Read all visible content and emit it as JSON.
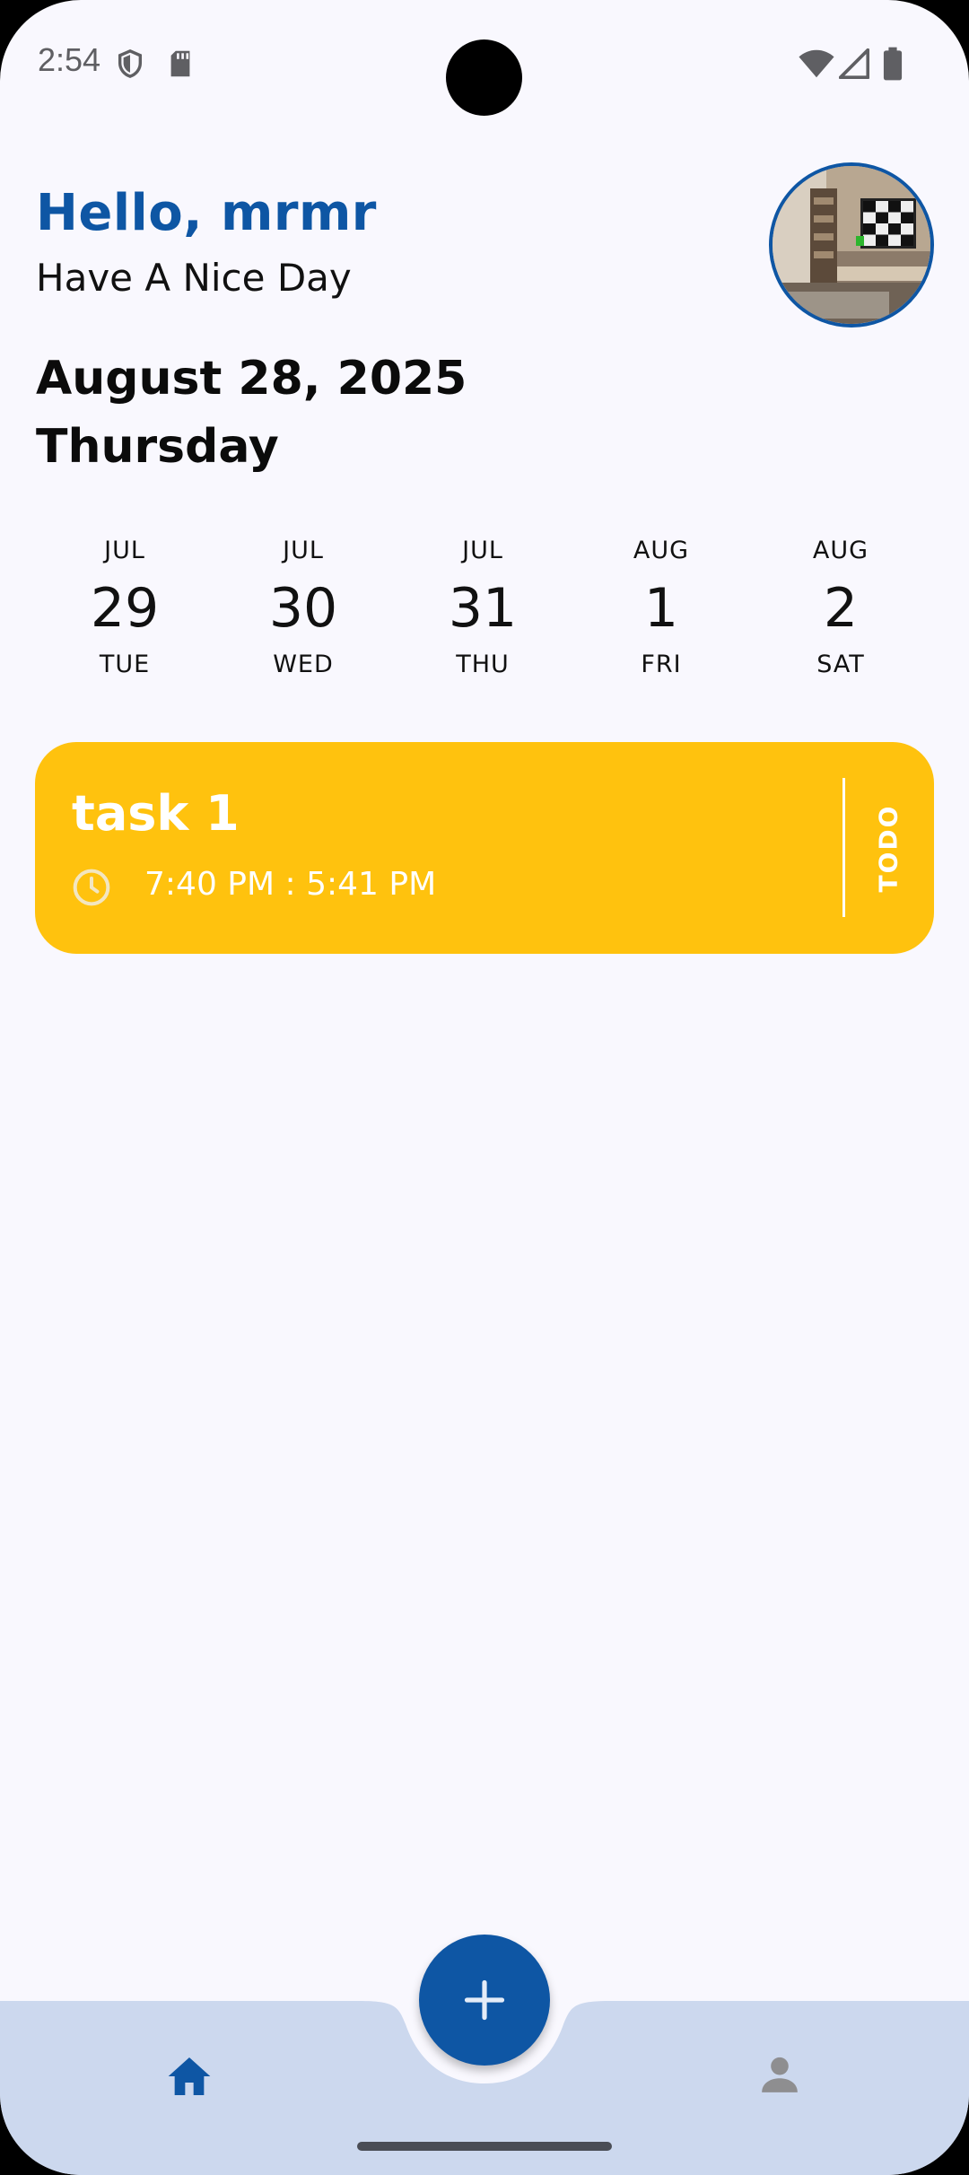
{
  "status_bar": {
    "time": "2:54",
    "icons": [
      "shield-icon",
      "sd-card-icon",
      "wifi-icon",
      "signal-icon",
      "battery-icon"
    ]
  },
  "header": {
    "greeting": "Hello, mrmr",
    "subtitle": "Have A Nice Day",
    "avatar": "profile-photo"
  },
  "date": {
    "full": "August 28, 2025",
    "weekday": "Thursday"
  },
  "day_strip": [
    {
      "month": "JUL",
      "day": "29",
      "dow": "TUE"
    },
    {
      "month": "JUL",
      "day": "30",
      "dow": "WED"
    },
    {
      "month": "JUL",
      "day": "31",
      "dow": "THU"
    },
    {
      "month": "AUG",
      "day": "1",
      "dow": "FRI"
    },
    {
      "month": "AUG",
      "day": "2",
      "dow": "SAT"
    }
  ],
  "tasks": [
    {
      "title": "task 1",
      "time": "7:40 PM : 5:41 PM",
      "status": "TODO"
    }
  ],
  "bottom_nav": {
    "items": [
      "home-icon",
      "profile-icon"
    ],
    "fab": "add-icon"
  },
  "colors": {
    "accent": "#0E56A4",
    "task_card": "#FFC20E",
    "background": "#F9F8FE",
    "nav_bar": "#CCD8EE"
  }
}
